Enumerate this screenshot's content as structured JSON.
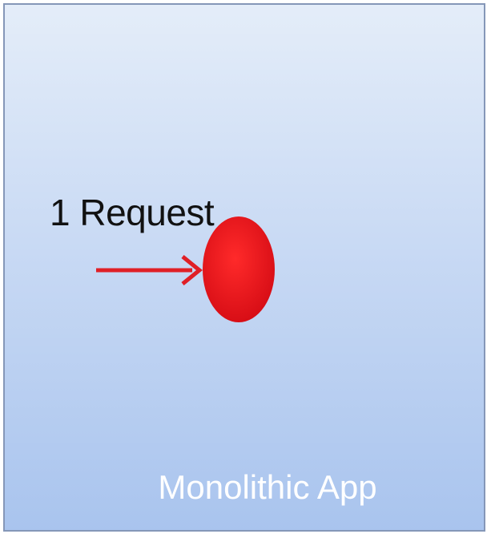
{
  "diagram": {
    "request_label": "1 Request",
    "app_label": "Monolithic App",
    "colors": {
      "request": "#e8131c",
      "arrow": "#e01f26",
      "box_border": "#8597b8",
      "box_fill_top": "#e4edf9",
      "box_fill_bottom": "#a9c4ee"
    }
  }
}
